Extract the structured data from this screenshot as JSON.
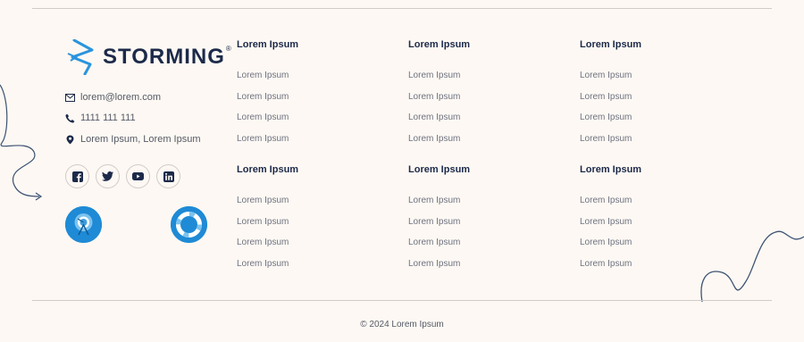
{
  "brand": {
    "name": "STORMING",
    "reg": "®"
  },
  "contact": {
    "email": "lorem@lorem.com",
    "phone": "1111 111 111",
    "address": "Lorem Ipsum, Lorem Ipsum"
  },
  "socials": [
    "facebook-icon",
    "twitter-icon",
    "youtube-icon",
    "linkedin-icon"
  ],
  "columns": [
    {
      "title": "Lorem Ipsum",
      "items": [
        "Lorem Ipsum",
        "Lorem Ipsum",
        "Lorem Ipsum",
        "Lorem Ipsum"
      ]
    },
    {
      "title": "Lorem Ipsum",
      "items": [
        "Lorem Ipsum",
        "Lorem Ipsum",
        "Lorem Ipsum",
        "Lorem Ipsum"
      ]
    },
    {
      "title": "Lorem Ipsum",
      "items": [
        "Lorem Ipsum",
        "Lorem Ipsum",
        "Lorem Ipsum",
        "Lorem Ipsum"
      ]
    },
    {
      "title": "Lorem Ipsum",
      "items": [
        "Lorem Ipsum",
        "Lorem Ipsum",
        "Lorem Ipsum",
        "Lorem Ipsum"
      ]
    },
    {
      "title": "Lorem Ipsum",
      "items": [
        "Lorem Ipsum",
        "Lorem Ipsum",
        "Lorem Ipsum",
        "Lorem Ipsum"
      ]
    },
    {
      "title": "Lorem Ipsum",
      "items": [
        "Lorem Ipsum",
        "Lorem Ipsum",
        "Lorem Ipsum",
        "Lorem Ipsum"
      ]
    }
  ],
  "copyright": "© 2024 Lorem Ipsum",
  "colors": {
    "brand": "#1c2a4a",
    "accent": "#1f8ad6",
    "background": "#fdf8f3"
  }
}
